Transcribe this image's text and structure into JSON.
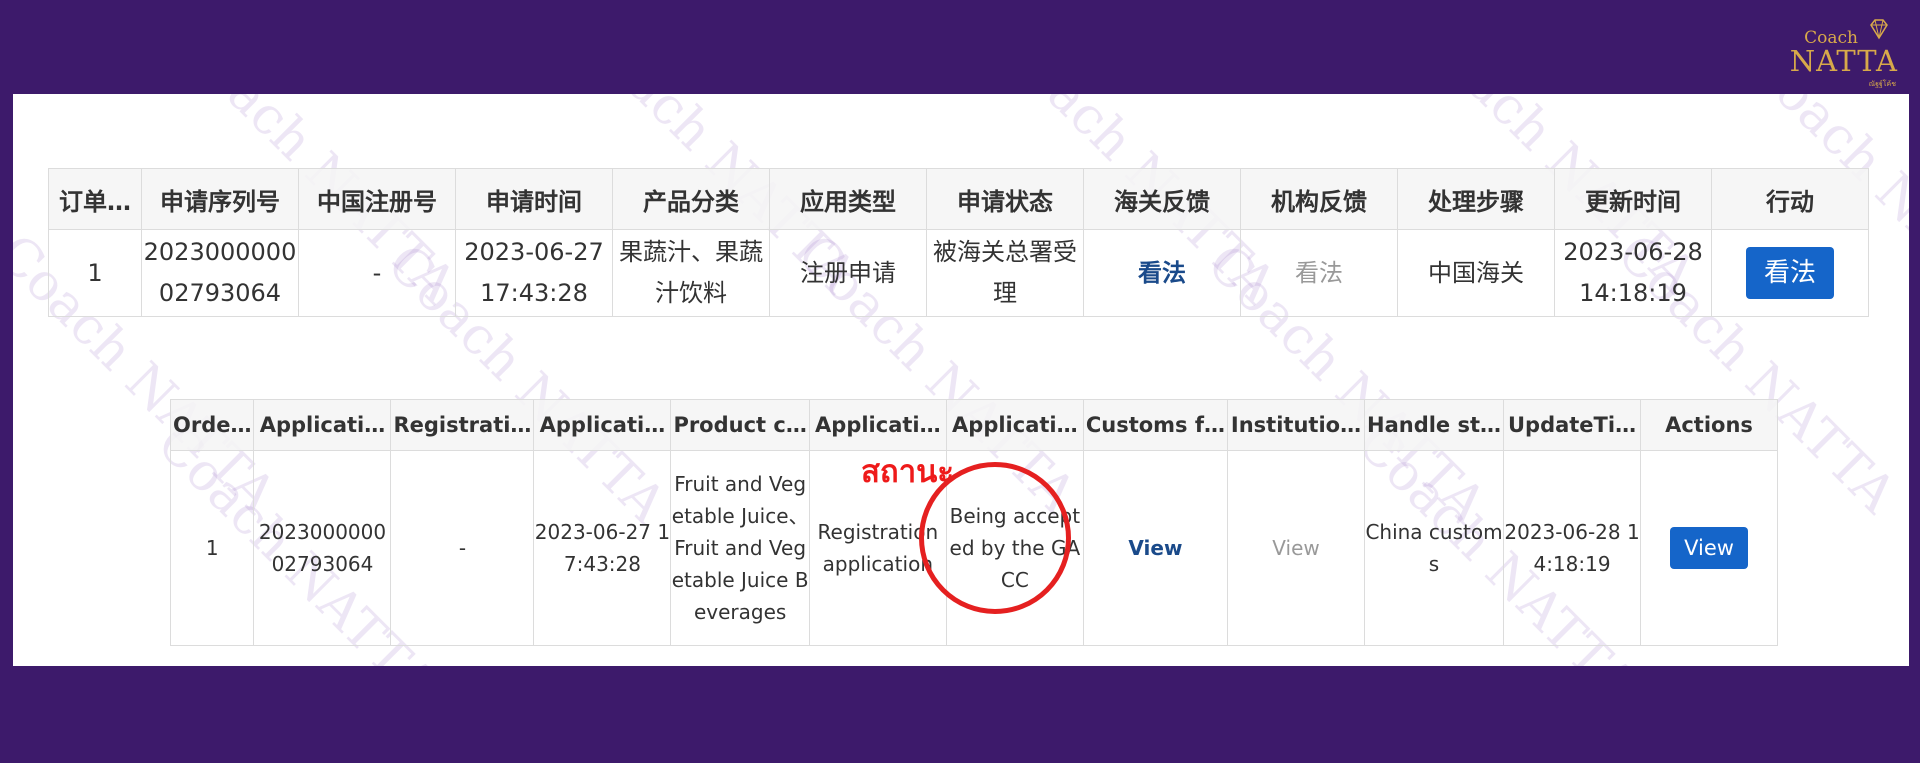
{
  "logo": {
    "line1": "Coach",
    "line2": "NATTA",
    "line3": "ณัฐฐ์โค้ช"
  },
  "watermark": "Coach NATTA",
  "table_cn": {
    "headers": [
      "订单…",
      "申请序列号",
      "中国注册号",
      "申请时间",
      "产品分类",
      "应用类型",
      "申请状态",
      "海关反馈",
      "机构反馈",
      "处理步骤",
      "更新时间",
      "行动"
    ],
    "row": {
      "order": "1",
      "serial": "2023000000 02793064",
      "cn_reg": "-",
      "apply_time": "2023-06-27 17:43:28",
      "category": "果蔬汁、果蔬汁饮料",
      "app_type": "注册申请",
      "status": "被海关总署受理",
      "customs_feedback": "看法",
      "inst_feedback": "看法",
      "step": "中国海关",
      "update_time": "2023-06-28 14:18:19",
      "action": "看法"
    }
  },
  "table_en": {
    "headers": [
      "Orde…",
      "Applicati…",
      "Registrati…",
      "Applicati…",
      "Product c…",
      "Applicati…",
      "Applicati…",
      "Customs f…",
      "Institutio…",
      "Handle st…",
      "UpdateTi…",
      "Actions"
    ],
    "row": {
      "order": "1",
      "serial": "2023000000 02793064",
      "reg": "-",
      "apply_time": "2023-06-27 17:43:28",
      "category": "Fruit and Vegetable Juice、Fruit and Vegetable Juice Beverages",
      "app_type": "Registration application",
      "status": "Being accepted by the GACC",
      "customs_feedback": "View",
      "inst_feedback": "View",
      "step": "China customs",
      "update_time": "2023-06-28 14:18:19",
      "action": "View"
    }
  },
  "annotation": {
    "label": "สถานะ",
    "color": "#ee1a1a"
  },
  "colors": {
    "background": "#3d1a6b",
    "button": "#1565c9",
    "logo": "#d8a94a"
  }
}
